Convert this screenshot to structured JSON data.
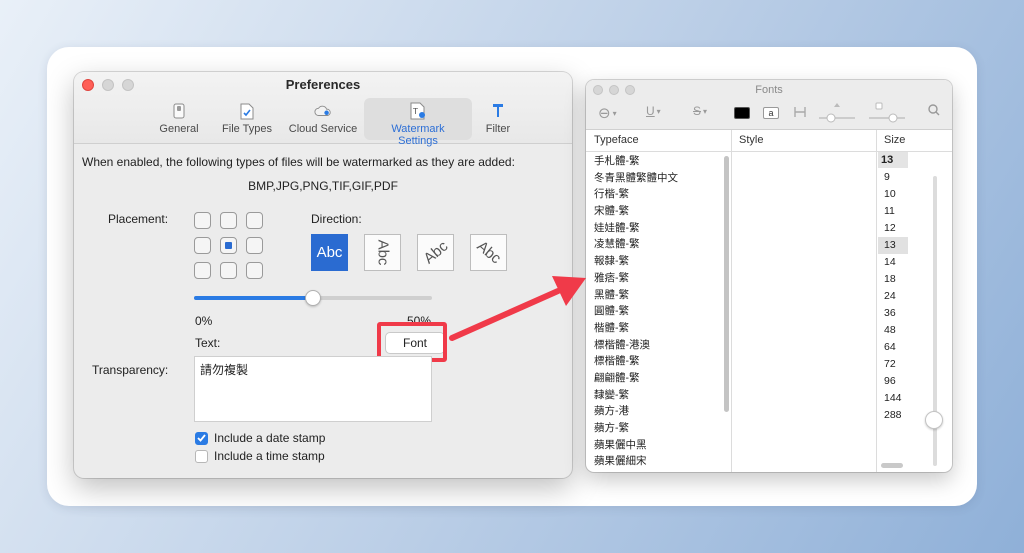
{
  "preferences": {
    "title": "Preferences",
    "tabs": [
      {
        "label": "General",
        "icon": "switch-icon"
      },
      {
        "label": "File Types",
        "icon": "document-check-icon"
      },
      {
        "label": "Cloud Service",
        "icon": "cloud-gear-icon"
      },
      {
        "label": "Watermark Settings",
        "icon": "watermark-document-icon",
        "active": true
      },
      {
        "label": "Filter",
        "icon": "filter-icon"
      }
    ],
    "intro": "When enabled, the following types of files will be watermarked as they are added:",
    "file_types": "BMP,JPG,PNG,TIF,GIF,PDF",
    "placement_label": "Placement:",
    "placement_selected": "center",
    "direction_label": "Direction:",
    "direction_sample": "Abc",
    "transparency_label": "Transparency:",
    "transparency_value": 0.5,
    "transparency_min": "0%",
    "transparency_max": "50%",
    "text_label": "Text:",
    "font_button": "Font",
    "watermark_text": "請勿複製",
    "date_stamp": {
      "label": "Include a date stamp",
      "checked": true
    },
    "time_stamp": {
      "label": "Include a time stamp",
      "checked": false
    },
    "accent_color": "#2a7be4",
    "highlight_color": "#f03a49"
  },
  "fonts": {
    "title": "Fonts",
    "toolbar": {
      "action_menu": "⊖",
      "underline": "U",
      "strikethrough": "S",
      "text_color": "#000000",
      "doc_color_glyph": "a"
    },
    "columns": {
      "typeface": "Typeface",
      "style": "Style",
      "size": "Size"
    },
    "typefaces": [
      "手札體-繁",
      "冬青黑體繁體中文",
      "行楷-繁",
      "宋體-繁",
      "娃娃體-繁",
      "凌慧體-繁",
      "報隸-繁",
      "雅痞-繁",
      "黑體-繁",
      "圓體-繁",
      "楷體-繁",
      "標楷體-港澳",
      "標楷體-繁",
      "翩翩體-繁",
      "隸變-繁",
      "蘋方-港",
      "蘋方-繁",
      "蘋果儷中黑",
      "蘋果儷細宋"
    ],
    "size_value": "13",
    "sizes": [
      "9",
      "10",
      "11",
      "12",
      "13",
      "14",
      "18",
      "24",
      "36",
      "48",
      "64",
      "72",
      "96",
      "144",
      "288"
    ],
    "selected_size": "13"
  }
}
